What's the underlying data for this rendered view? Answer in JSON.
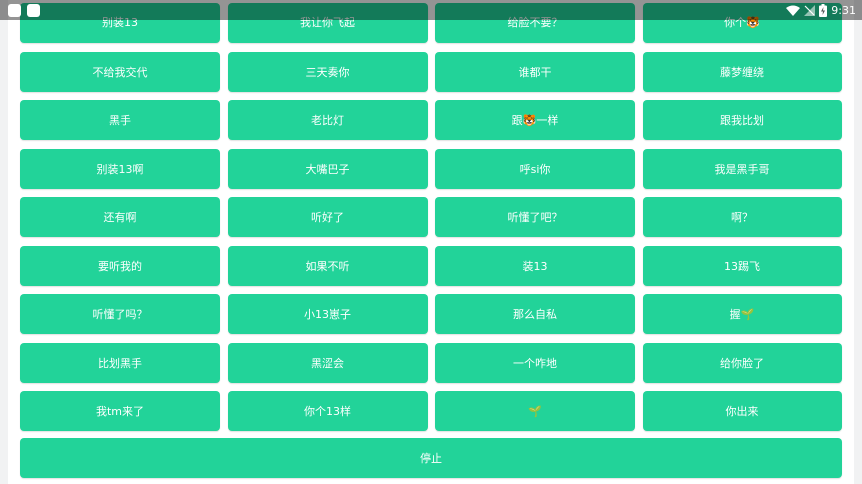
{
  "status_bar": {
    "time": "9:31",
    "icons": [
      "notification-square-icon",
      "notification-square-icon",
      "wifi-icon",
      "signal-off-icon",
      "battery-charging-icon"
    ]
  },
  "buttons": [
    {
      "label": "别装13"
    },
    {
      "label": "我让你飞起"
    },
    {
      "label": "给脸不要？"
    },
    {
      "label": "你个🐯"
    },
    {
      "label": "不给我交代"
    },
    {
      "label": "三天奏你"
    },
    {
      "label": "谁都干"
    },
    {
      "label": "藤梦缠绕"
    },
    {
      "label": "黑手"
    },
    {
      "label": "老比灯"
    },
    {
      "label": "跟🐯一样"
    },
    {
      "label": "跟我比划"
    },
    {
      "label": "别装13啊"
    },
    {
      "label": "大嘴巴子"
    },
    {
      "label": "呼si你"
    },
    {
      "label": "我是黑手哥"
    },
    {
      "label": "还有啊"
    },
    {
      "label": "听好了"
    },
    {
      "label": "听懂了吧？"
    },
    {
      "label": "啊？"
    },
    {
      "label": "要听我的"
    },
    {
      "label": "如果不听"
    },
    {
      "label": "装13"
    },
    {
      "label": "13踢飞"
    },
    {
      "label": "听懂了吗？"
    },
    {
      "label": "小13崽子"
    },
    {
      "label": "那么自私"
    },
    {
      "label": "握🌱"
    },
    {
      "label": "比划黑手"
    },
    {
      "label": "黑涩会"
    },
    {
      "label": "一个咋地"
    },
    {
      "label": "给你脸了"
    },
    {
      "label": "我tm来了"
    },
    {
      "label": "你个13样"
    },
    {
      "label": "🌱"
    },
    {
      "label": "你出来"
    }
  ],
  "stop_button": {
    "label": "停止"
  },
  "colors": {
    "button": "#22d399",
    "text": "#ffffff",
    "status_bar": "#000000"
  }
}
